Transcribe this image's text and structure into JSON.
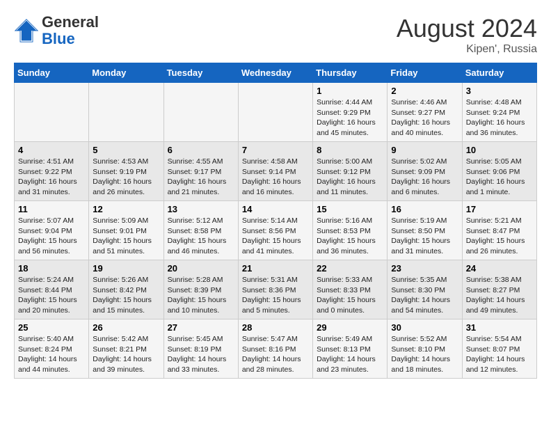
{
  "header": {
    "logo_general": "General",
    "logo_blue": "Blue",
    "title": "August 2024",
    "subtitle": "Kipen', Russia"
  },
  "days_of_week": [
    "Sunday",
    "Monday",
    "Tuesday",
    "Wednesday",
    "Thursday",
    "Friday",
    "Saturday"
  ],
  "weeks": [
    [
      {
        "day": "",
        "info": ""
      },
      {
        "day": "",
        "info": ""
      },
      {
        "day": "",
        "info": ""
      },
      {
        "day": "",
        "info": ""
      },
      {
        "day": "1",
        "info": "Sunrise: 4:44 AM\nSunset: 9:29 PM\nDaylight: 16 hours\nand 45 minutes."
      },
      {
        "day": "2",
        "info": "Sunrise: 4:46 AM\nSunset: 9:27 PM\nDaylight: 16 hours\nand 40 minutes."
      },
      {
        "day": "3",
        "info": "Sunrise: 4:48 AM\nSunset: 9:24 PM\nDaylight: 16 hours\nand 36 minutes."
      }
    ],
    [
      {
        "day": "4",
        "info": "Sunrise: 4:51 AM\nSunset: 9:22 PM\nDaylight: 16 hours\nand 31 minutes."
      },
      {
        "day": "5",
        "info": "Sunrise: 4:53 AM\nSunset: 9:19 PM\nDaylight: 16 hours\nand 26 minutes."
      },
      {
        "day": "6",
        "info": "Sunrise: 4:55 AM\nSunset: 9:17 PM\nDaylight: 16 hours\nand 21 minutes."
      },
      {
        "day": "7",
        "info": "Sunrise: 4:58 AM\nSunset: 9:14 PM\nDaylight: 16 hours\nand 16 minutes."
      },
      {
        "day": "8",
        "info": "Sunrise: 5:00 AM\nSunset: 9:12 PM\nDaylight: 16 hours\nand 11 minutes."
      },
      {
        "day": "9",
        "info": "Sunrise: 5:02 AM\nSunset: 9:09 PM\nDaylight: 16 hours\nand 6 minutes."
      },
      {
        "day": "10",
        "info": "Sunrise: 5:05 AM\nSunset: 9:06 PM\nDaylight: 16 hours\nand 1 minute."
      }
    ],
    [
      {
        "day": "11",
        "info": "Sunrise: 5:07 AM\nSunset: 9:04 PM\nDaylight: 15 hours\nand 56 minutes."
      },
      {
        "day": "12",
        "info": "Sunrise: 5:09 AM\nSunset: 9:01 PM\nDaylight: 15 hours\nand 51 minutes."
      },
      {
        "day": "13",
        "info": "Sunrise: 5:12 AM\nSunset: 8:58 PM\nDaylight: 15 hours\nand 46 minutes."
      },
      {
        "day": "14",
        "info": "Sunrise: 5:14 AM\nSunset: 8:56 PM\nDaylight: 15 hours\nand 41 minutes."
      },
      {
        "day": "15",
        "info": "Sunrise: 5:16 AM\nSunset: 8:53 PM\nDaylight: 15 hours\nand 36 minutes."
      },
      {
        "day": "16",
        "info": "Sunrise: 5:19 AM\nSunset: 8:50 PM\nDaylight: 15 hours\nand 31 minutes."
      },
      {
        "day": "17",
        "info": "Sunrise: 5:21 AM\nSunset: 8:47 PM\nDaylight: 15 hours\nand 26 minutes."
      }
    ],
    [
      {
        "day": "18",
        "info": "Sunrise: 5:24 AM\nSunset: 8:44 PM\nDaylight: 15 hours\nand 20 minutes."
      },
      {
        "day": "19",
        "info": "Sunrise: 5:26 AM\nSunset: 8:42 PM\nDaylight: 15 hours\nand 15 minutes."
      },
      {
        "day": "20",
        "info": "Sunrise: 5:28 AM\nSunset: 8:39 PM\nDaylight: 15 hours\nand 10 minutes."
      },
      {
        "day": "21",
        "info": "Sunrise: 5:31 AM\nSunset: 8:36 PM\nDaylight: 15 hours\nand 5 minutes."
      },
      {
        "day": "22",
        "info": "Sunrise: 5:33 AM\nSunset: 8:33 PM\nDaylight: 15 hours\nand 0 minutes."
      },
      {
        "day": "23",
        "info": "Sunrise: 5:35 AM\nSunset: 8:30 PM\nDaylight: 14 hours\nand 54 minutes."
      },
      {
        "day": "24",
        "info": "Sunrise: 5:38 AM\nSunset: 8:27 PM\nDaylight: 14 hours\nand 49 minutes."
      }
    ],
    [
      {
        "day": "25",
        "info": "Sunrise: 5:40 AM\nSunset: 8:24 PM\nDaylight: 14 hours\nand 44 minutes."
      },
      {
        "day": "26",
        "info": "Sunrise: 5:42 AM\nSunset: 8:21 PM\nDaylight: 14 hours\nand 39 minutes."
      },
      {
        "day": "27",
        "info": "Sunrise: 5:45 AM\nSunset: 8:19 PM\nDaylight: 14 hours\nand 33 minutes."
      },
      {
        "day": "28",
        "info": "Sunrise: 5:47 AM\nSunset: 8:16 PM\nDaylight: 14 hours\nand 28 minutes."
      },
      {
        "day": "29",
        "info": "Sunrise: 5:49 AM\nSunset: 8:13 PM\nDaylight: 14 hours\nand 23 minutes."
      },
      {
        "day": "30",
        "info": "Sunrise: 5:52 AM\nSunset: 8:10 PM\nDaylight: 14 hours\nand 18 minutes."
      },
      {
        "day": "31",
        "info": "Sunrise: 5:54 AM\nSunset: 8:07 PM\nDaylight: 14 hours\nand 12 minutes."
      }
    ]
  ]
}
